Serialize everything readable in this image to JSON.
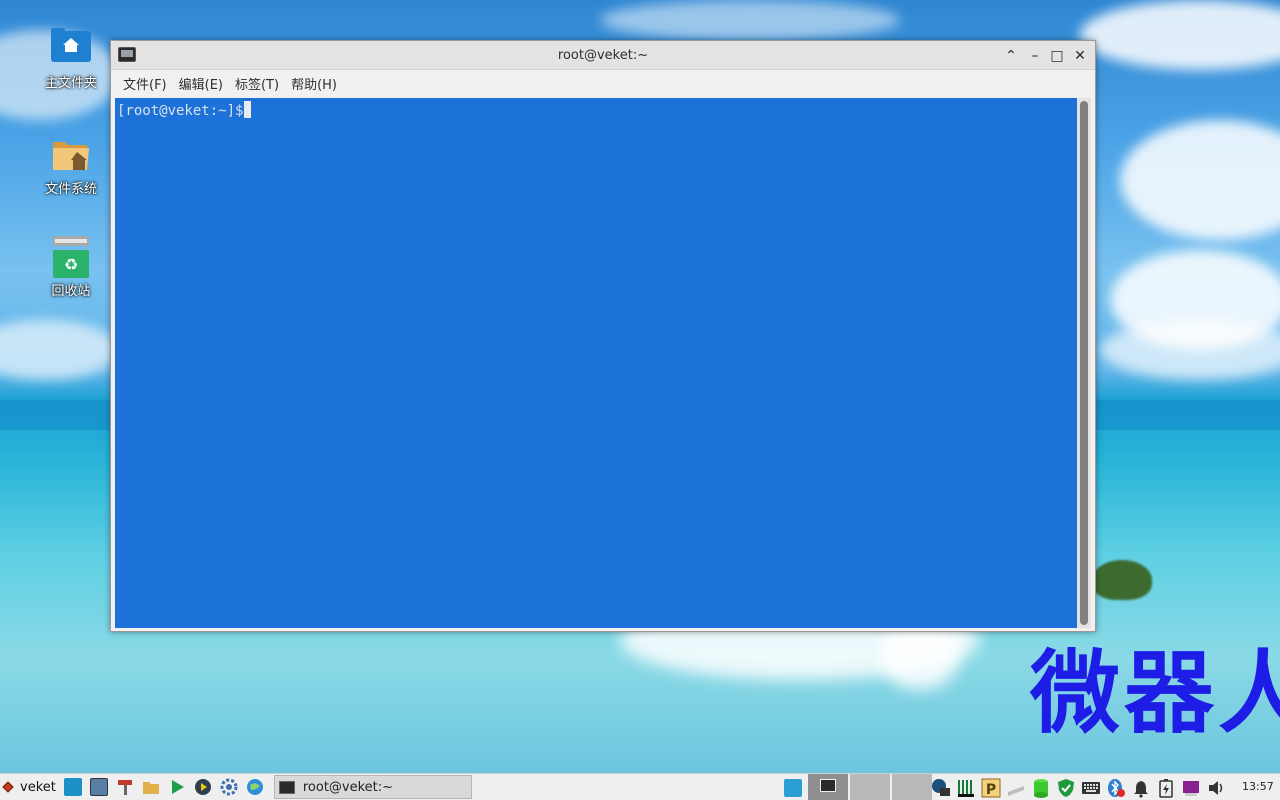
{
  "desktop": {
    "icons": [
      {
        "label": "主文件夹",
        "icon": "home-folder-icon"
      },
      {
        "label": "文件系统",
        "icon": "filesystem-icon"
      },
      {
        "label": "回收站",
        "icon": "trash-icon"
      }
    ],
    "watermark": "微器人"
  },
  "terminal": {
    "title": "root@veket:~",
    "menu": [
      "文件(F)",
      "编辑(E)",
      "标签(T)",
      "帮助(H)"
    ],
    "prompt": "[root@veket:~]$",
    "background_color": "#1c72d9"
  },
  "window_controls": {
    "up": "⌃",
    "minimize": "–",
    "maximize": "□",
    "close": "✕"
  },
  "taskbar": {
    "start_label": "veket",
    "task_label": "root@veket:~",
    "clock": "13:57",
    "quick_launch": [
      "show-desktop-icon",
      "image-viewer-icon",
      "tools-icon",
      "file-manager-icon",
      "play-icon",
      "media-icon",
      "settings-icon",
      "browser-icon"
    ],
    "tray_icons": [
      "network-icon",
      "signal-icon",
      "parking-icon",
      "usb-icon",
      "database-icon",
      "shield-icon",
      "keyboard-icon",
      "bluetooth-icon",
      "bell-icon",
      "battery-icon",
      "app-icon",
      "volume-icon"
    ]
  }
}
